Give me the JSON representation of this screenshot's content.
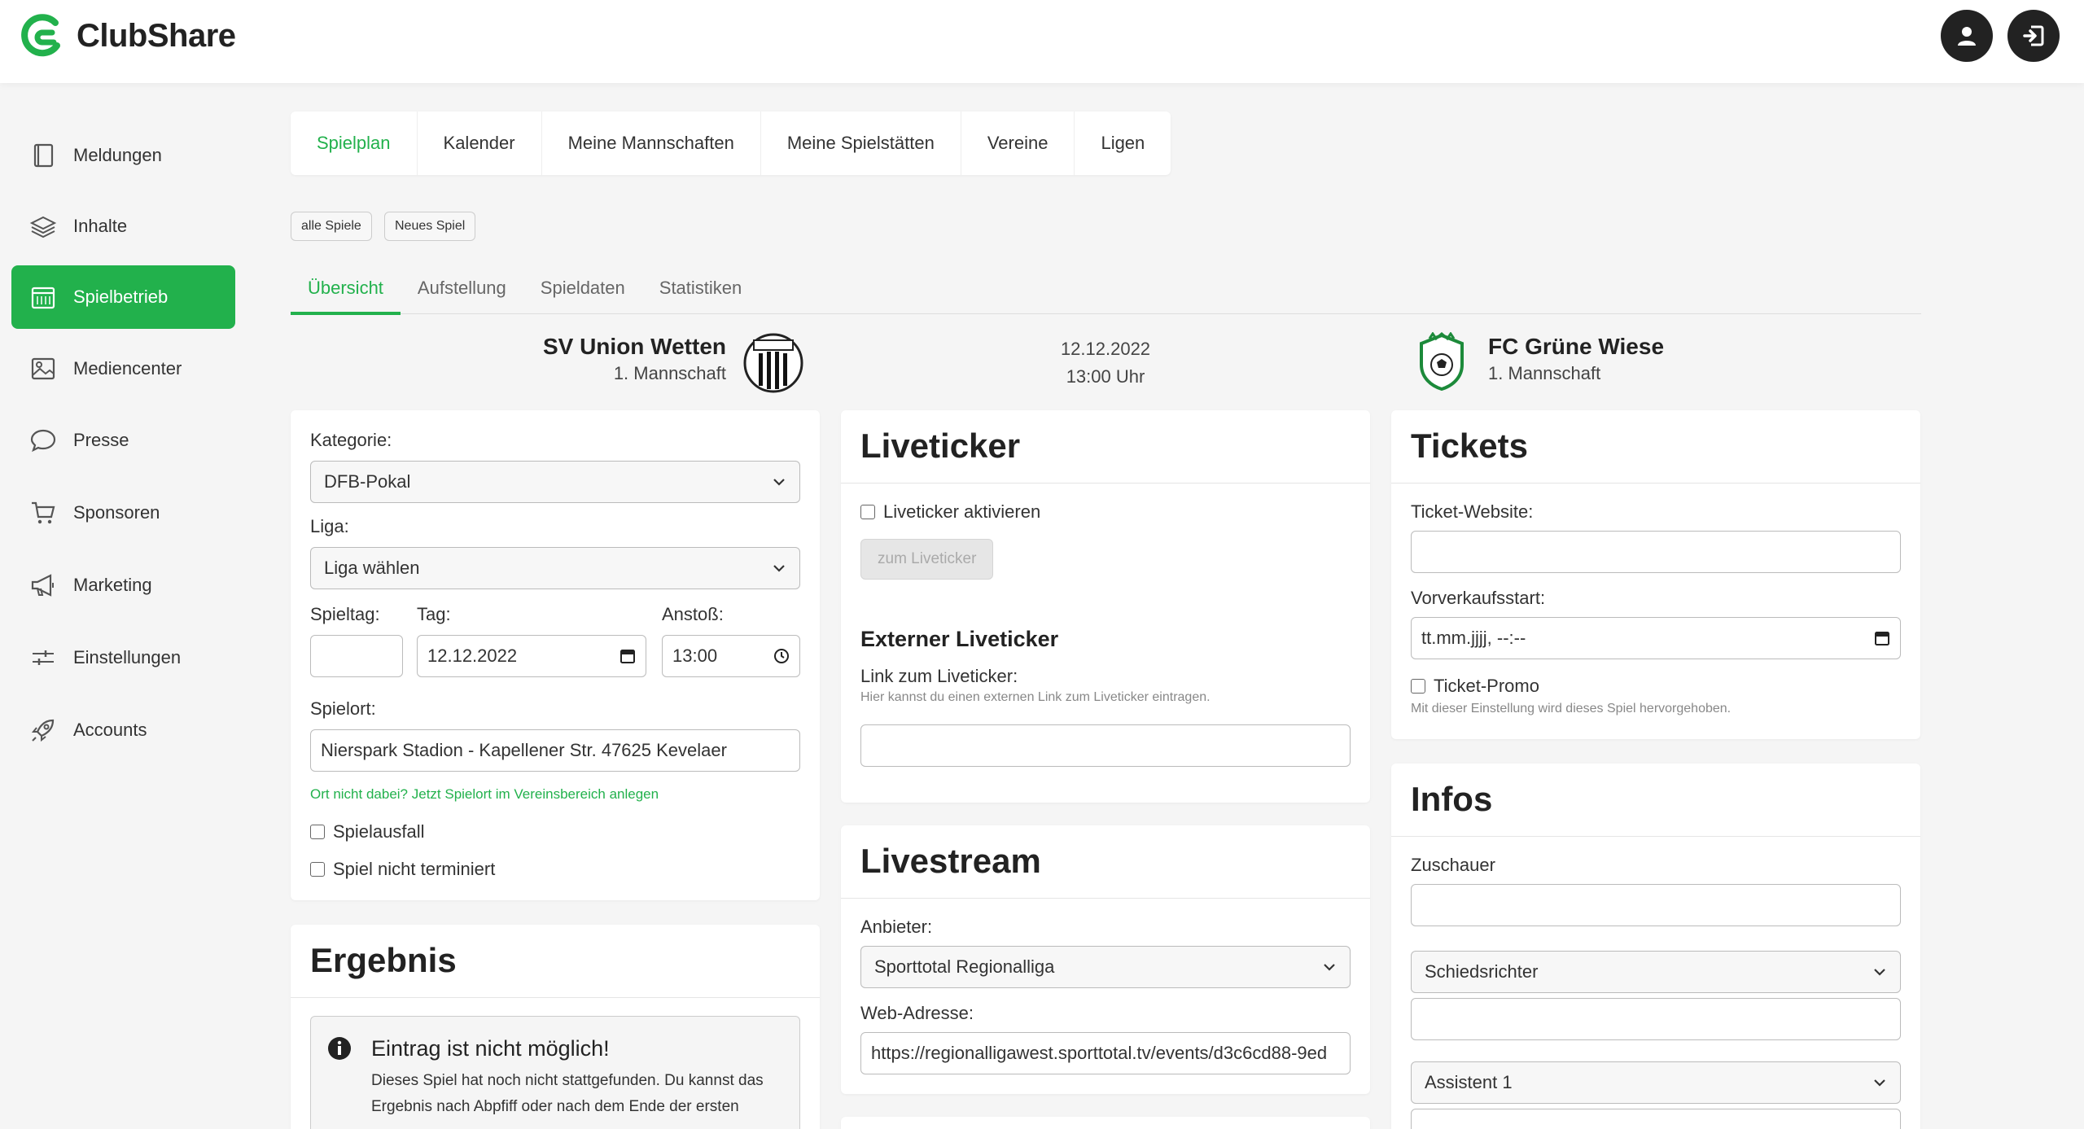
{
  "app": {
    "name": "ClubShare"
  },
  "colors": {
    "accent": "#22b14c",
    "dark": "#222222"
  },
  "header": {
    "icons": [
      "user-icon",
      "logout-icon"
    ]
  },
  "sidebar": {
    "items": [
      {
        "label": "Meldungen",
        "icon": "book-icon"
      },
      {
        "label": "Inhalte",
        "icon": "layers-icon"
      },
      {
        "label": "Spielbetrieb",
        "icon": "calendar-icon",
        "active": true
      },
      {
        "label": "Mediencenter",
        "icon": "image-icon"
      },
      {
        "label": "Presse",
        "icon": "chat-icon"
      },
      {
        "label": "Sponsoren",
        "icon": "cart-icon"
      },
      {
        "label": "Marketing",
        "icon": "megaphone-icon"
      },
      {
        "label": "Einstellungen",
        "icon": "sliders-icon"
      },
      {
        "label": "Accounts",
        "icon": "rocket-icon"
      }
    ]
  },
  "tabs": [
    "Spielplan",
    "Kalender",
    "Meine Mannschaften",
    "Meine Spielstätten",
    "Vereine",
    "Ligen"
  ],
  "pills": [
    "alle Spiele",
    "Neues Spiel"
  ],
  "subtabs": [
    "Übersicht",
    "Aufstellung",
    "Spieldaten",
    "Statistiken"
  ],
  "match": {
    "home": {
      "name": "SV Union Wetten",
      "team": "1. Mannschaft"
    },
    "date": "12.12.2022",
    "time": "13:00 Uhr",
    "away": {
      "name": "FC Grüne Wiese",
      "team": "1. Mannschaft"
    }
  },
  "form": {
    "kategorie_label": "Kategorie:",
    "kategorie_value": "DFB-Pokal",
    "liga_label": "Liga:",
    "liga_value": "Liga wählen",
    "spieltag_label": "Spieltag:",
    "spieltag_value": "",
    "tag_label": "Tag:",
    "tag_value": "12.12.2022",
    "anstoss_label": "Anstoß:",
    "anstoss_value": "13:00",
    "spielort_label": "Spielort:",
    "spielort_value": "Nierspark Stadion - Kapellener Str. 47625 Kevelaer",
    "spielort_link": "Ort nicht dabei? Jetzt Spielort im Vereinsbereich anlegen",
    "spielausfall": "Spielausfall",
    "nicht_terminiert": "Spiel nicht terminiert"
  },
  "ergebnis": {
    "title": "Ergebnis",
    "alert_title": "Eintrag ist nicht möglich!",
    "alert_line1": "Dieses Spiel hat noch nicht stattgefunden. Du kannst das",
    "alert_line2": "Ergebnis nach Abpfiff oder nach dem Ende der ersten"
  },
  "liveticker": {
    "title": "Liveticker",
    "activate": "Liveticker aktivieren",
    "button": "zum Liveticker",
    "external_title": "Externer Liveticker",
    "link_label": "Link zum Liveticker:",
    "link_hint": "Hier kannst du einen externen Link zum Liveticker eintragen.",
    "link_value": ""
  },
  "livestream": {
    "title": "Livestream",
    "provider_label": "Anbieter:",
    "provider_value": "Sporttotal Regionalliga",
    "url_label": "Web-Adresse:",
    "url_value": "https://regionalligawest.sporttotal.tv/events/d3c6cd88-9ed"
  },
  "tickets": {
    "title": "Tickets",
    "website_label": "Ticket-Website:",
    "website_value": "",
    "presale_label": "Vorverkaufsstart:",
    "presale_value": "tt.mm.jjjj, --:--",
    "promo_label": "Ticket-Promo",
    "promo_hint": "Mit dieser Einstellung wird dieses Spiel hervorgehoben."
  },
  "infos": {
    "title": "Infos",
    "zuschauer_label": "Zuschauer",
    "zuschauer_value": "",
    "referee_select": "Schiedsrichter",
    "referee_value": "",
    "assistant_select": "Assistent 1",
    "assistant_value": ""
  }
}
